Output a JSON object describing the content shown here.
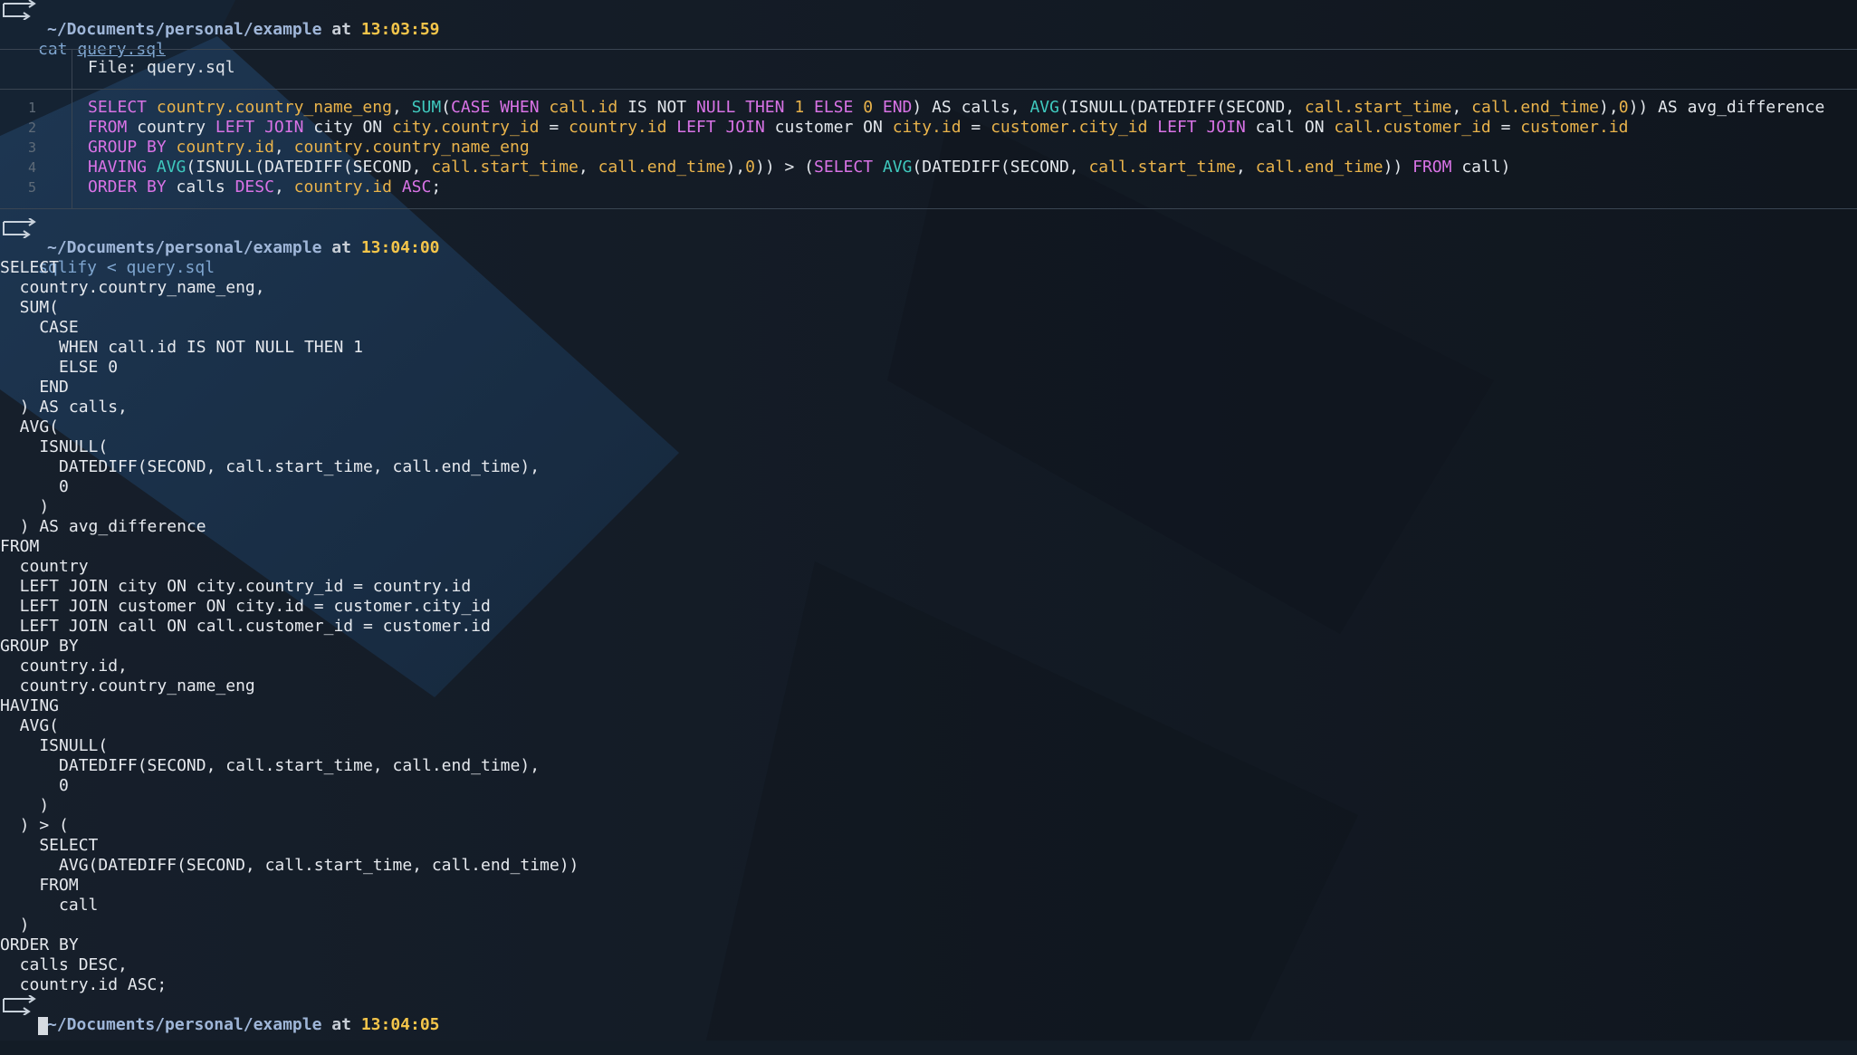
{
  "prompts": [
    {
      "path": "~/Documents/personal/example",
      "at": "at",
      "time": "13:03:59",
      "command": "cat",
      "arg": "query.sql"
    },
    {
      "path": "~/Documents/personal/example",
      "at": "at",
      "time": "13:04:00",
      "command": "sqlify < query.sql"
    },
    {
      "path": "~/Documents/personal/example",
      "at": "at",
      "time": "13:04:05"
    }
  ],
  "file_view": {
    "header": "File: query.sql",
    "line_numbers": [
      "1",
      "2",
      "3",
      "4",
      "5"
    ]
  },
  "sql_lines": [
    [
      [
        "k",
        "SELECT "
      ],
      [
        "q",
        "country.country_name_eng"
      ],
      [
        "p",
        ", "
      ],
      [
        "f",
        "SUM"
      ],
      [
        "p",
        "("
      ],
      [
        "k",
        "CASE WHEN "
      ],
      [
        "q",
        "call.id"
      ],
      [
        "p",
        " IS NOT "
      ],
      [
        "k",
        "NULL THEN "
      ],
      [
        "n",
        "1 "
      ],
      [
        "k",
        "ELSE "
      ],
      [
        "n",
        "0 "
      ],
      [
        "k",
        "END"
      ],
      [
        "p",
        ") AS calls, "
      ],
      [
        "f",
        "AVG"
      ],
      [
        "p",
        "(ISNULL(DATEDIFF(SECOND, "
      ],
      [
        "q",
        "call.start_time"
      ],
      [
        "p",
        ", "
      ],
      [
        "q",
        "call.end_time"
      ],
      [
        "p",
        "),"
      ],
      [
        "n",
        "0"
      ],
      [
        "p",
        ")) AS avg_difference"
      ]
    ],
    [
      [
        "k",
        "FROM "
      ],
      [
        "p",
        "country "
      ],
      [
        "k",
        "LEFT JOIN "
      ],
      [
        "p",
        "city ON "
      ],
      [
        "q",
        "city.country_id"
      ],
      [
        "p",
        " = "
      ],
      [
        "q",
        "country.id"
      ],
      [
        "k",
        " LEFT JOIN "
      ],
      [
        "p",
        "customer ON "
      ],
      [
        "q",
        "city.id"
      ],
      [
        "p",
        " = "
      ],
      [
        "q",
        "customer.city_id"
      ],
      [
        "k",
        " LEFT JOIN "
      ],
      [
        "p",
        "call ON "
      ],
      [
        "q",
        "call.customer_id"
      ],
      [
        "p",
        " = "
      ],
      [
        "q",
        "customer.id"
      ]
    ],
    [
      [
        "k",
        "GROUP BY "
      ],
      [
        "q",
        "country.id"
      ],
      [
        "p",
        ", "
      ],
      [
        "q",
        "country.country_name_eng"
      ]
    ],
    [
      [
        "k",
        "HAVING "
      ],
      [
        "f",
        "AVG"
      ],
      [
        "p",
        "(ISNULL(DATEDIFF(SECOND, "
      ],
      [
        "q",
        "call.start_time"
      ],
      [
        "p",
        ", "
      ],
      [
        "q",
        "call.end_time"
      ],
      [
        "p",
        "),"
      ],
      [
        "n",
        "0"
      ],
      [
        "p",
        ")) > ("
      ],
      [
        "k",
        "SELECT "
      ],
      [
        "f",
        "AVG"
      ],
      [
        "p",
        "(DATEDIFF(SECOND, "
      ],
      [
        "q",
        "call.start_time"
      ],
      [
        "p",
        ", "
      ],
      [
        "q",
        "call.end_time"
      ],
      [
        "p",
        ")) "
      ],
      [
        "k",
        "FROM "
      ],
      [
        "p",
        "call)"
      ]
    ],
    [
      [
        "k",
        "ORDER BY "
      ],
      [
        "p",
        "calls "
      ],
      [
        "k",
        "DESC"
      ],
      [
        "p",
        ", "
      ],
      [
        "q",
        "country.id"
      ],
      [
        "k",
        " ASC"
      ],
      [
        "p",
        ";"
      ]
    ]
  ],
  "output_lines": [
    "SELECT",
    "  country.country_name_eng,",
    "  SUM(",
    "    CASE",
    "      WHEN call.id IS NOT NULL THEN 1",
    "      ELSE 0",
    "    END",
    "  ) AS calls,",
    "  AVG(",
    "    ISNULL(",
    "      DATEDIFF(SECOND, call.start_time, call.end_time),",
    "      0",
    "    )",
    "  ) AS avg_difference",
    "FROM",
    "  country",
    "  LEFT JOIN city ON city.country_id = country.id",
    "  LEFT JOIN customer ON city.id = customer.city_id",
    "  LEFT JOIN call ON call.customer_id = customer.id",
    "GROUP BY",
    "  country.id,",
    "  country.country_name_eng",
    "HAVING",
    "  AVG(",
    "    ISNULL(",
    "      DATEDIFF(SECOND, call.start_time, call.end_time),",
    "      0",
    "    )",
    "  ) > (",
    "    SELECT",
    "      AVG(DATEDIFF(SECOND, call.start_time, call.end_time))",
    "    FROM",
    "      call",
    "  )",
    "ORDER BY",
    "  calls DESC,",
    "  country.id ASC;"
  ]
}
